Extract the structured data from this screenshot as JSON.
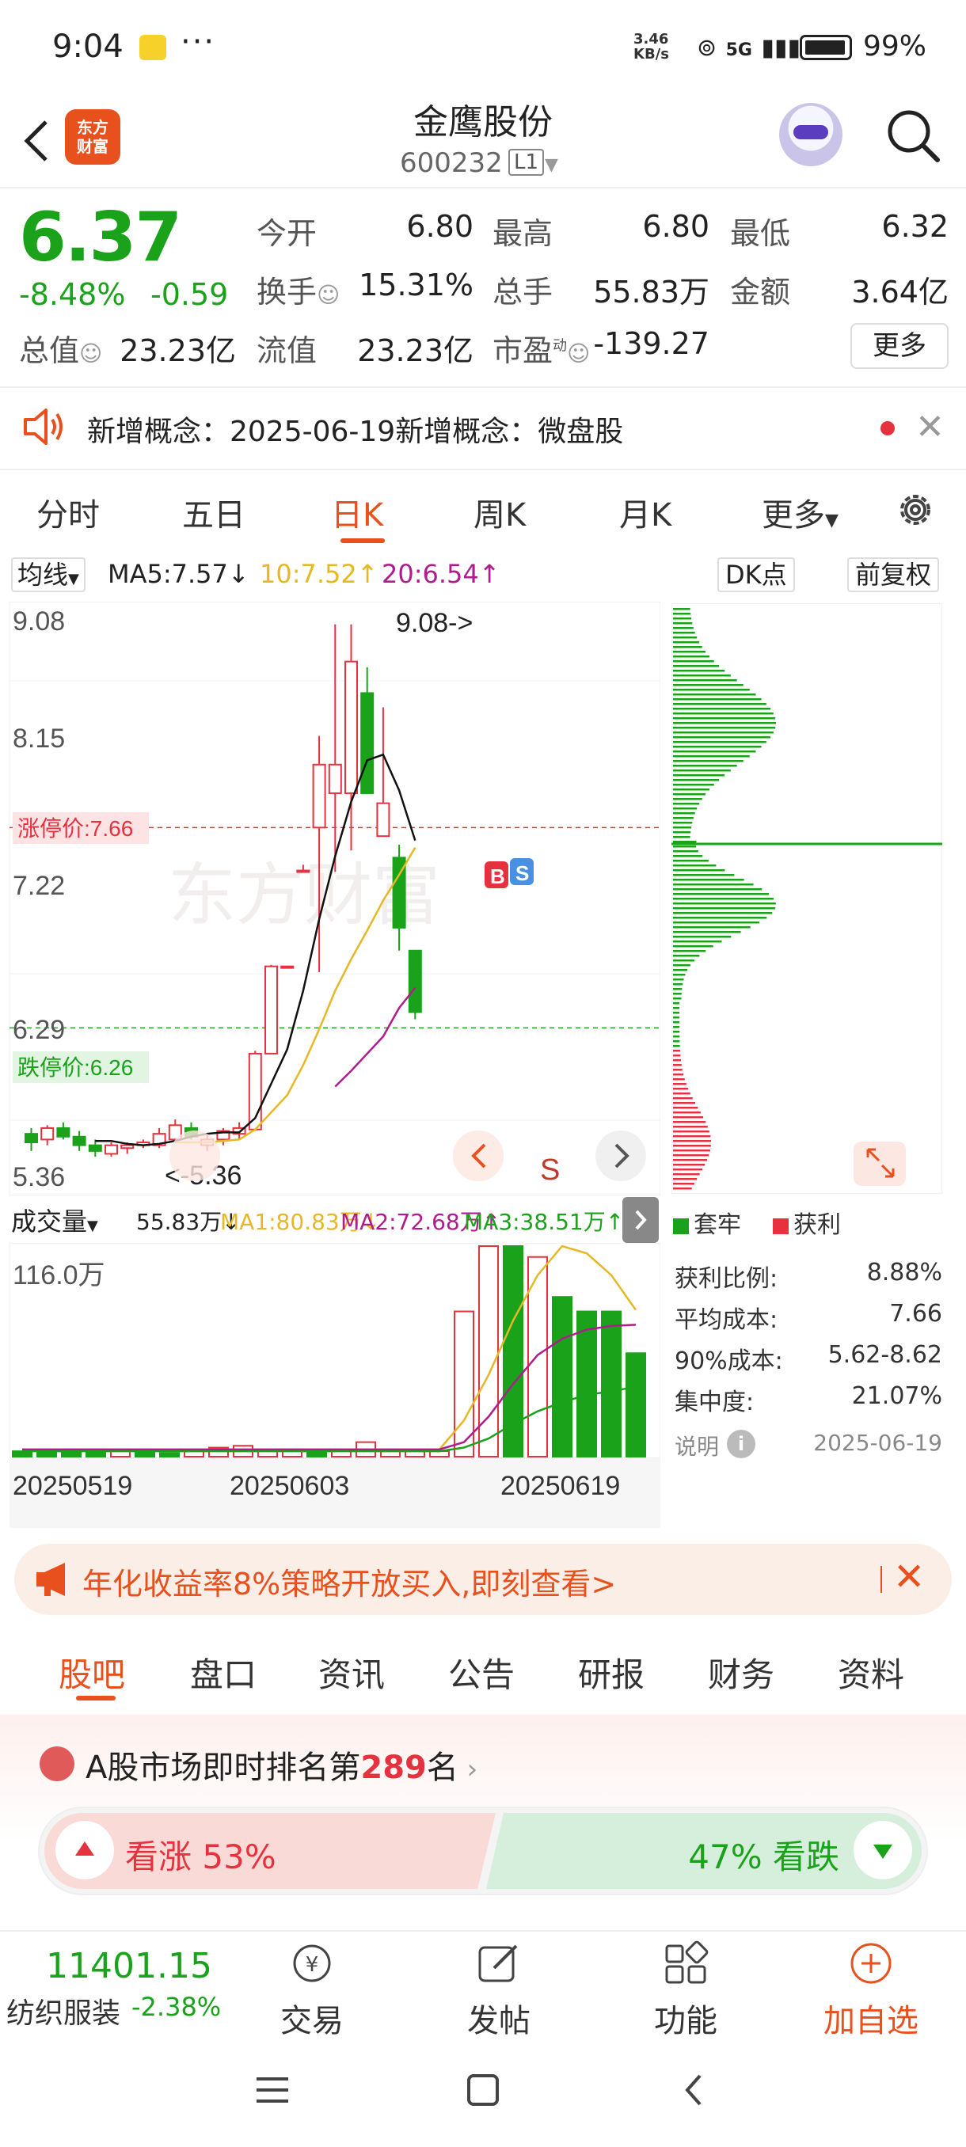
{
  "status_bar": {
    "time": "9:04",
    "dots": "···",
    "speed_line1": "3.46",
    "speed_line2": "KB/s",
    "network": "5G",
    "battery": "99%"
  },
  "header": {
    "logo_line1": "东方",
    "logo_line2": "财富",
    "stock_name": "金鹰股份",
    "stock_code": "600232",
    "level": "L1"
  },
  "quote": {
    "price": "6.37",
    "change_pct": "-8.48%",
    "change_amt": "-0.59",
    "fields": [
      {
        "label": "今开",
        "value": "6.80",
        "color": "green"
      },
      {
        "label": "最高",
        "value": "6.80",
        "color": "green"
      },
      {
        "label": "最低",
        "value": "6.32",
        "color": "green"
      },
      {
        "label": "换手",
        "value": "15.31%",
        "color": "black"
      },
      {
        "label": "总手",
        "value": "55.83万",
        "color": "black"
      },
      {
        "label": "金额",
        "value": "3.64亿",
        "color": "black"
      },
      {
        "label": "总值",
        "value": "23.23亿",
        "color": "black"
      },
      {
        "label": "流值",
        "value": "23.23亿",
        "color": "black"
      },
      {
        "label": "市盈",
        "value": "-139.27",
        "color": "black"
      }
    ],
    "pe_sup": "动",
    "more_label": "更多"
  },
  "concept": {
    "text": "新增概念：2025-06-19新增概念：微盘股"
  },
  "chart_tabs": [
    "分时",
    "五日",
    "日K",
    "周K",
    "月K",
    "更多"
  ],
  "chart_toolbar": {
    "ma_select": "均线",
    "ma5": "MA5:7.57↓",
    "ma10": "10:7.52↑",
    "ma20": "20:6.54↑",
    "dk_label": "DK点",
    "adjust_label": "前复权"
  },
  "kline": {
    "price_labels": [
      "9.08",
      "8.15",
      "7.22",
      "6.29",
      "5.36"
    ],
    "limit_up": "涨停价:7.66",
    "limit_down": "跌停价:6.26",
    "high_marker": "9.08->",
    "low_marker": "<-5.36",
    "watermark": "东方财富",
    "buy_tag": "B",
    "sell_tag": "S",
    "s_marker": "S"
  },
  "chart_data": {
    "type": "candlestick",
    "ylim": [
      5.2,
      9.15
    ],
    "limit_up": 7.66,
    "limit_down": 6.26,
    "candles": [
      {
        "o": 5.52,
        "h": 5.56,
        "l": 5.4,
        "c": 5.46
      },
      {
        "o": 5.48,
        "h": 5.58,
        "l": 5.44,
        "c": 5.56
      },
      {
        "o": 5.56,
        "h": 5.6,
        "l": 5.48,
        "c": 5.5
      },
      {
        "o": 5.5,
        "h": 5.54,
        "l": 5.4,
        "c": 5.44
      },
      {
        "o": 5.44,
        "h": 5.48,
        "l": 5.36,
        "c": 5.4
      },
      {
        "o": 5.38,
        "h": 5.46,
        "l": 5.36,
        "c": 5.44
      },
      {
        "o": 5.42,
        "h": 5.46,
        "l": 5.38,
        "c": 5.44
      },
      {
        "o": 5.44,
        "h": 5.48,
        "l": 5.42,
        "c": 5.46
      },
      {
        "o": 5.44,
        "h": 5.56,
        "l": 5.42,
        "c": 5.52
      },
      {
        "o": 5.48,
        "h": 5.62,
        "l": 5.46,
        "c": 5.58
      },
      {
        "o": 5.56,
        "h": 5.6,
        "l": 5.48,
        "c": 5.5
      },
      {
        "o": 5.44,
        "h": 5.52,
        "l": 5.4,
        "c": 5.48
      },
      {
        "o": 5.48,
        "h": 5.56,
        "l": 5.44,
        "c": 5.54
      },
      {
        "o": 5.52,
        "h": 5.6,
        "l": 5.48,
        "c": 5.56
      },
      {
        "o": 5.55,
        "h": 6.1,
        "l": 5.54,
        "c": 6.08
      },
      {
        "o": 6.08,
        "h": 6.7,
        "l": 6.08,
        "c": 6.69
      },
      {
        "o": 6.69,
        "h": 6.69,
        "l": 6.69,
        "c": 6.69
      },
      {
        "o": 7.36,
        "h": 7.4,
        "l": 7.36,
        "c": 7.36
      },
      {
        "o": 7.66,
        "h": 8.3,
        "l": 6.65,
        "c": 8.1
      },
      {
        "o": 7.9,
        "h": 9.08,
        "l": 7.35,
        "c": 8.1
      },
      {
        "o": 7.9,
        "h": 9.08,
        "l": 7.5,
        "c": 8.82
      },
      {
        "o": 8.6,
        "h": 8.78,
        "l": 7.9,
        "c": 7.9
      },
      {
        "o": 7.6,
        "h": 8.5,
        "l": 7.6,
        "c": 7.83
      },
      {
        "o": 7.45,
        "h": 7.54,
        "l": 6.8,
        "c": 6.96
      },
      {
        "o": 6.8,
        "h": 6.8,
        "l": 6.32,
        "c": 6.37
      }
    ],
    "ma5": [
      null,
      null,
      null,
      null,
      5.47,
      5.47,
      5.45,
      5.44,
      5.45,
      5.47,
      5.5,
      5.52,
      5.53,
      5.53,
      5.63,
      5.87,
      6.11,
      6.52,
      7.02,
      7.46,
      7.84,
      8.13,
      8.17,
      7.92,
      7.57
    ],
    "ma10": [
      null,
      null,
      null,
      null,
      null,
      null,
      null,
      null,
      null,
      5.46,
      5.46,
      5.46,
      5.47,
      5.48,
      5.55,
      5.67,
      5.79,
      6.0,
      6.25,
      6.52,
      6.74,
      6.94,
      7.15,
      7.33,
      7.52
    ],
    "ma20": [
      null,
      null,
      null,
      null,
      null,
      null,
      null,
      null,
      null,
      null,
      null,
      null,
      null,
      null,
      null,
      null,
      null,
      null,
      null,
      5.85,
      5.96,
      6.08,
      6.2,
      6.4,
      6.54
    ]
  },
  "volume": {
    "select": "成交量",
    "total": "55.83万↓",
    "ma1": "MA1:80.83万↓",
    "ma2": "MA2:72.68万↑",
    "ma3": "MA3:38.51万↑",
    "max_label": "116.0万",
    "dates": [
      "20250519",
      "20250603",
      "20250619"
    ],
    "bars": [
      3,
      3,
      4,
      4,
      3,
      3,
      2,
      3,
      5,
      6,
      3,
      4,
      3,
      3,
      8,
      3,
      3,
      3,
      80,
      116,
      116,
      110,
      88,
      80,
      80,
      57
    ],
    "bar_colors": [
      "g",
      "g",
      "g",
      "g",
      "r",
      "g",
      "g",
      "r",
      "r",
      "r",
      "r",
      "r",
      "g",
      "r",
      "r",
      "r",
      "r",
      "r",
      "r",
      "r",
      "g",
      "r",
      "g",
      "g",
      "g",
      "g"
    ]
  },
  "chips": {
    "legend_hold": "套牢",
    "legend_profit": "获利",
    "stats": [
      {
        "label": "获利比例:",
        "value": "8.88%"
      },
      {
        "label": "平均成本:",
        "value": "7.66"
      },
      {
        "label": "90%成本:",
        "value": "5.62-8.62"
      },
      {
        "label": "集中度:",
        "value": "21.07%"
      }
    ],
    "note_label": "说明",
    "note_date": "2025-06-19"
  },
  "ad": {
    "text": "年化收益率8%策略开放买入,即刻查看>"
  },
  "bottom_tabs": [
    "股吧",
    "盘口",
    "资讯",
    "公告",
    "研报",
    "财务",
    "资料"
  ],
  "ranking": {
    "prefix": "A股市场即时排名第",
    "rank": "289",
    "suffix": "名",
    "up_text": "看涨 53%",
    "down_text": "47% 看跌"
  },
  "toolbar": {
    "index_value": "11401.15",
    "index_name": "纺织服装",
    "index_change": "-2.38%",
    "items": [
      "交易",
      "发帖",
      "功能",
      "加自选"
    ]
  },
  "colors": {
    "accent": "#e8501d",
    "up": "#e5323e",
    "down": "#1aa31a",
    "ma5": "#111111",
    "ma10": "#e7b825",
    "ma20": "#b01b8e"
  }
}
